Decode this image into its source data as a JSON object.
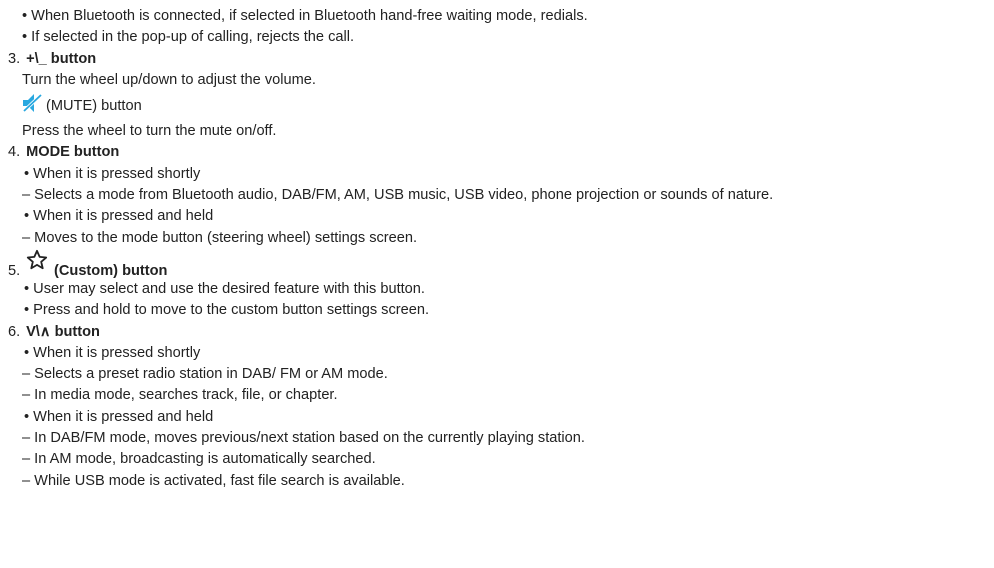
{
  "colors": {
    "text": "#222222",
    "mute_icon": "#29a8e0",
    "star_icon": "#222222"
  },
  "icons": {
    "mute": "mute-speaker-icon",
    "custom": "star-outline-icon"
  },
  "lines": {
    "l1": "• When Bluetooth is connected, if selected in Bluetooth hand-free waiting mode, redials.",
    "l2": "• If selected in the pop-up of calling, rejects the call.",
    "item3_num": "3.",
    "item3_title": "+\\_ button",
    "l3a": "Turn the wheel up/down to adjust the volume.",
    "mute_label": "(MUTE) button",
    "l3b": "Press the wheel to turn the mute on/off.",
    "item4_num": "4.",
    "item4_title": "MODE button",
    "l4a": "• When it is pressed shortly",
    "l4b": "– Selects a mode from Bluetooth audio, DAB/FM, AM, USB music, USB video, phone projection or sounds of nature.",
    "l4c": "• When it is pressed and held",
    "l4d": "– Moves to the mode button (steering wheel) settings screen.",
    "item5_num": "5.",
    "item5_title": "(Custom) button",
    "l5a": "• User may select and use the desired feature with this button.",
    "l5b": "• Press and hold to move to the custom button settings screen.",
    "item6_num": "6.",
    "item6_title": "V\\∧ button",
    "l6a": "• When it is pressed shortly",
    "l6b": "– Selects a preset radio station in DAB/ FM or AM mode.",
    "l6c": "– In media mode, searches track, file, or chapter.",
    "l6d": "• When it is pressed and held",
    "l6e": "– In DAB/FM mode, moves previous/next station based on the currently playing station.",
    "l6f": "– In AM mode, broadcasting is automatically searched.",
    "l6g": "– While USB mode is activated, fast file search is available."
  }
}
